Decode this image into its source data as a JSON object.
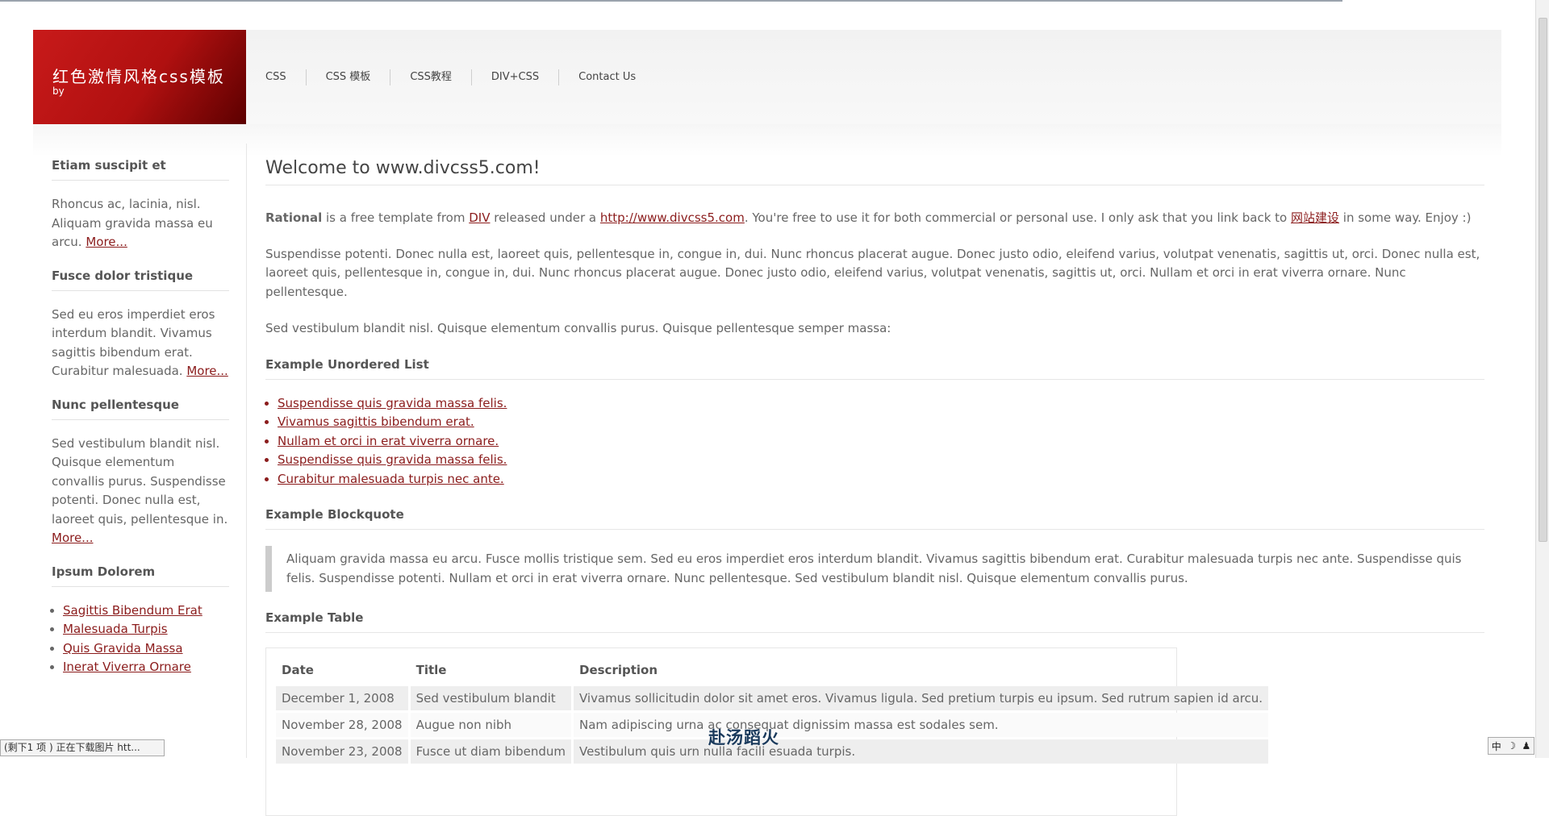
{
  "header": {
    "logo_title": "红色激情风格css模板",
    "logo_by": "by",
    "nav": [
      "CSS",
      "CSS 模板",
      "CSS教程",
      "DIV+CSS",
      "Contact Us"
    ]
  },
  "sidebar": {
    "sections": [
      {
        "title": "Etiam suscipit et",
        "text": "Rhoncus ac, lacinia, nisl. Aliquam gravida massa eu arcu.",
        "more": "More..."
      },
      {
        "title": "Fusce dolor tristique",
        "text": "Sed eu eros imperdiet eros interdum blandit. Vivamus sagittis bibendum erat. Curabitur malesuada.",
        "more": "More..."
      },
      {
        "title": "Nunc pellentesque",
        "text": "Sed vestibulum blandit nisl. Quisque elementum convallis purus. Suspendisse potenti. Donec nulla est, laoreet quis, pellentesque in.",
        "more": "More..."
      }
    ],
    "list_title": "Ipsum Dolorem",
    "links": [
      "Sagittis Bibendum Erat",
      "Malesuada Turpis",
      "Quis Gravida Massa",
      "Inerat Viverra Ornare"
    ]
  },
  "main": {
    "title": "Welcome to www.divcss5.com!",
    "intro": {
      "bold": "Rational",
      "t1": " is a free template from ",
      "link1": "DIV",
      "t2": " released under a ",
      "link2": "http://www.divcss5.com",
      "t3": ". You're free to use it for both commercial or personal use. I only ask that you link back to ",
      "link3": "网站建设",
      "t4": " in some way. Enjoy :)"
    },
    "para2": "Suspendisse potenti. Donec nulla est, laoreet quis, pellentesque in, congue in, dui. Nunc rhoncus placerat augue. Donec justo odio, eleifend varius, volutpat venenatis, sagittis ut, orci. Donec nulla est, laoreet quis, pellentesque in, congue in, dui. Nunc rhoncus placerat augue. Donec justo odio, eleifend varius, volutpat venenatis, sagittis ut, orci. Nullam et orci in erat viverra ornare. Nunc pellentesque.",
    "para3": "Sed vestibulum blandit nisl. Quisque elementum convallis purus. Quisque pellentesque semper massa:",
    "ul_title": "Example Unordered List",
    "ul_items": [
      "Suspendisse quis gravida massa felis.",
      "Vivamus sagittis bibendum erat.",
      "Nullam et orci in erat viverra ornare.",
      "Suspendisse quis gravida massa felis.",
      "Curabitur malesuada turpis nec ante."
    ],
    "bq_title": "Example Blockquote",
    "blockquote": "Aliquam gravida massa eu arcu. Fusce mollis tristique sem. Sed eu eros imperdiet eros interdum blandit. Vivamus sagittis bibendum erat. Curabitur malesuada turpis nec ante. Suspendisse quis felis. Suspendisse potenti. Nullam et orci in erat viverra ornare. Nunc pellentesque. Sed vestibulum blandit nisl. Quisque elementum convallis purus.",
    "table_title": "Example Table",
    "table": {
      "headers": [
        "Date",
        "Title",
        "Description"
      ],
      "rows": [
        [
          "December 1, 2008",
          "Sed vestibulum blandit",
          "Vivamus sollicitudin dolor sit amet eros. Vivamus ligula. Sed pretium turpis eu ipsum. Sed rutrum sapien id arcu."
        ],
        [
          "November 28, 2008",
          "Augue non nibh",
          "Nam adipiscing urna ac consequat dignissim massa est sodales sem."
        ],
        [
          "November 23, 2008",
          "Fusce ut diam bibendum",
          "Vestibulum quis urn nulla facili                 esuada           turpis."
        ]
      ]
    }
  },
  "status": "(剩下1 项 ) 正在下载图片 htt...",
  "ime_overlay": "赴汤蹈火",
  "tray": [
    "中",
    "☽",
    "♟"
  ],
  "colors": {
    "accent": "#8b1c1c",
    "logo": "#b01010"
  }
}
